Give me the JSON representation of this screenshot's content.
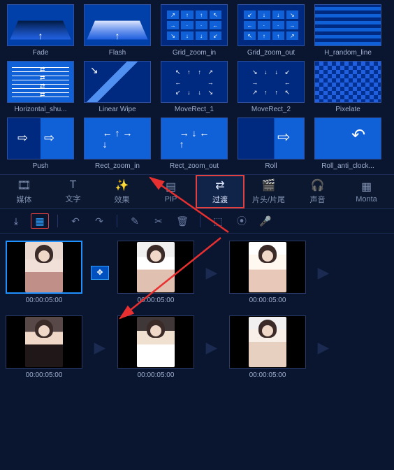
{
  "transitions": [
    {
      "id": "fade",
      "label": "Fade"
    },
    {
      "id": "flash",
      "label": "Flash"
    },
    {
      "id": "grid_zoom_in",
      "label": "Grid_zoom_in"
    },
    {
      "id": "grid_zoom_out",
      "label": "Grid_zoom_out"
    },
    {
      "id": "h_random_line",
      "label": "H_random_line"
    },
    {
      "id": "horizontal_shu",
      "label": "Horizontal_shu..."
    },
    {
      "id": "linear_wipe",
      "label": "Linear Wipe"
    },
    {
      "id": "moverect_1",
      "label": "MoveRect_1"
    },
    {
      "id": "moverect_2",
      "label": "MoveRect_2"
    },
    {
      "id": "pixelate",
      "label": "Pixelate"
    },
    {
      "id": "push",
      "label": "Push"
    },
    {
      "id": "rect_zoom_in",
      "label": "Rect_zoom_in"
    },
    {
      "id": "rect_zoom_out",
      "label": "Rect_zoom_out"
    },
    {
      "id": "roll",
      "label": "Roll"
    },
    {
      "id": "roll_anti_clock",
      "label": "Roll_anti_clock..."
    }
  ],
  "main_tabs": {
    "media": "媒体",
    "text": "文字",
    "effects": "效果",
    "pip": "PIP",
    "transition": "过渡",
    "intro": "片头/片尾",
    "sound": "声音",
    "montage": "Monta"
  },
  "timeline": {
    "row1": [
      {
        "time": "00:00:05:00",
        "selected": true
      },
      {
        "time": "00:00:05:00"
      },
      {
        "time": "00:00:05:00"
      }
    ],
    "row2": [
      {
        "time": "00:00:05:00"
      },
      {
        "time": "00:00:05:00"
      },
      {
        "time": "00:00:05:00"
      }
    ],
    "applied_transition_between_0_1": "rect_zoom_in"
  }
}
